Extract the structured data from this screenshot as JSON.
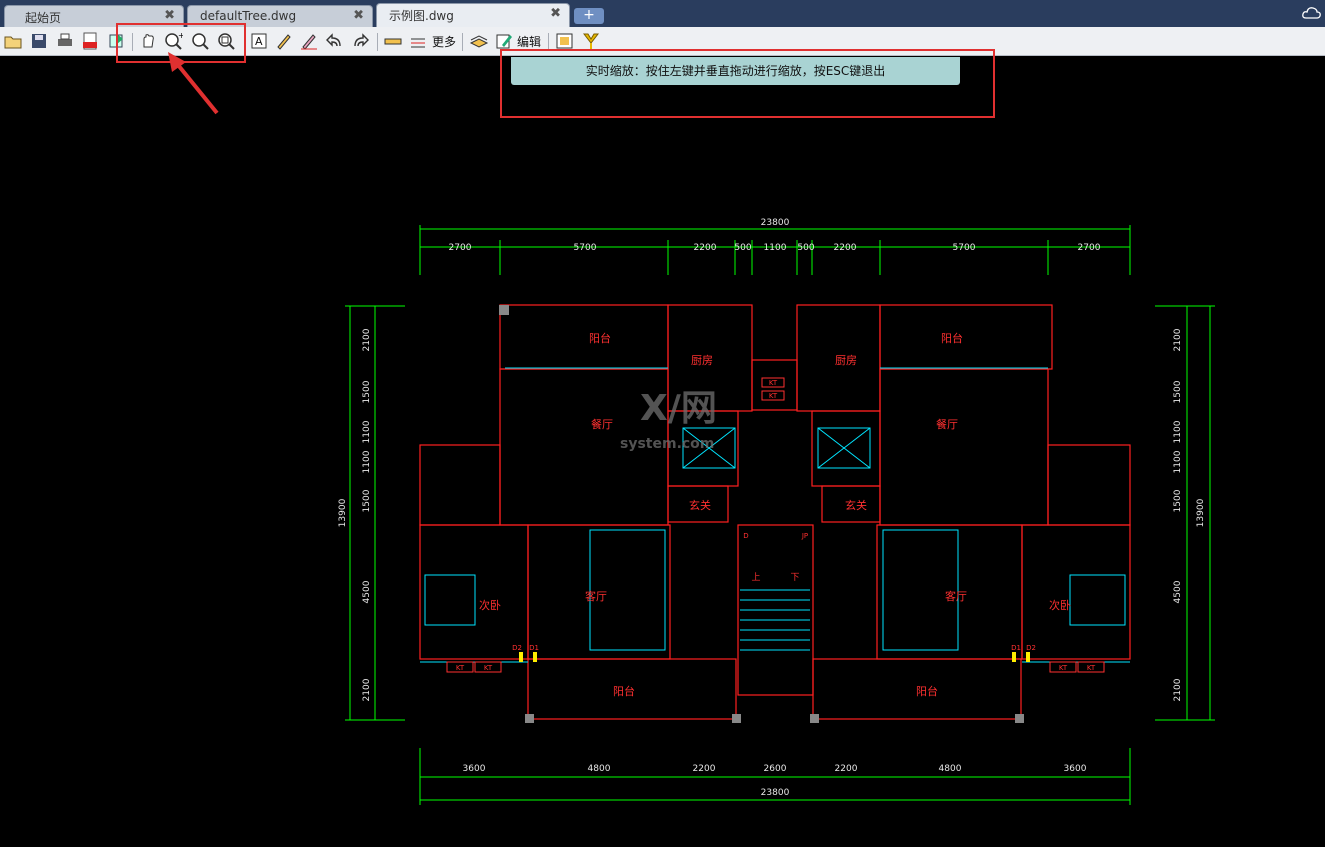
{
  "tabs": [
    {
      "label": "起始页",
      "close": "✖"
    },
    {
      "label": "defaultTree.dwg",
      "close": "✖"
    },
    {
      "label": "示例图.dwg",
      "close": "✖"
    }
  ],
  "add_tab_label": "+",
  "toolbar": {
    "more_label": "更多",
    "edit_label": "编辑"
  },
  "hint": "实时缩放：按住左键并垂直拖动进行缩放，按ESC键退出",
  "drawing": {
    "dims_top_total": "23800",
    "dims_top": [
      "2700",
      "5700",
      "2200",
      "500",
      "1100",
      "500",
      "2200",
      "5700",
      "2700"
    ],
    "dims_bottom_total": "23800",
    "dims_bottom": [
      "3600",
      "4800",
      "2200",
      "2600",
      "2200",
      "4800",
      "3600"
    ],
    "dims_left_total": "13900",
    "dims_left": [
      "2100",
      "1500",
      "1100",
      "1100",
      "1500",
      "4500",
      "2100"
    ],
    "dims_right_total": "13900",
    "dims_right": [
      "2100",
      "1500",
      "1100",
      "1100",
      "1500",
      "4500",
      "2100"
    ],
    "rooms": {
      "balcony_top_left": "阳台",
      "balcony_top_right": "阳台",
      "kitchen_left": "厨房",
      "kitchen_right": "厨房",
      "dining_left": "餐厅",
      "dining_right": "餐厅",
      "foyer_left": "玄关",
      "foyer_right": "玄关",
      "living_left": "客厅",
      "living_right": "客厅",
      "bedroom_left": "次卧",
      "bedroom_right": "次卧",
      "balcony_bottom_left": "阳台",
      "balcony_bottom_right": "阳台",
      "stair_up": "上",
      "stair_down": "下",
      "kt1": "KT",
      "kt2": "KT",
      "kt3": "KT",
      "kt4": "KT",
      "kt5": "KT",
      "kt6": "KT",
      "d1_left": "D1",
      "d1_right": "D1",
      "d2_left": "D2",
      "d2_right": "D2",
      "d_mid": "D",
      "jp_mid": "JP"
    },
    "watermark": "X/网",
    "watermark_sub": "system.com"
  },
  "colors": {
    "accent_red": "#e03030",
    "dim_green": "#00ff00",
    "wall_red": "#ff2020",
    "cyan": "#00e5ff",
    "hint_bg": "#a9d3d3"
  }
}
